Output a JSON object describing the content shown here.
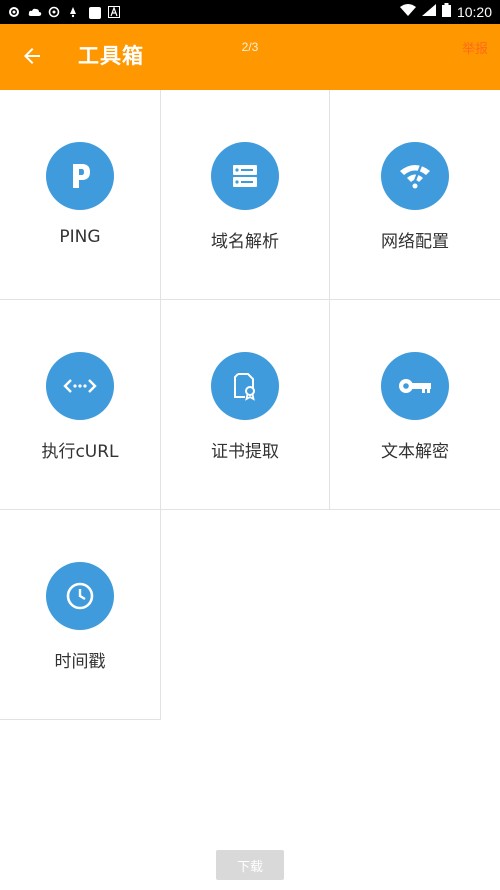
{
  "status_bar": {
    "time": "10:20"
  },
  "header": {
    "title": "工具箱",
    "page_indicator": "2/3",
    "report_link": "举报"
  },
  "tools": [
    {
      "label": "PING",
      "icon": "ping-p-icon"
    },
    {
      "label": "域名解析",
      "icon": "server-icon"
    },
    {
      "label": "网络配置",
      "icon": "wifi-icon"
    },
    {
      "label": "执行cURL",
      "icon": "code-arrows-icon"
    },
    {
      "label": "证书提取",
      "icon": "certificate-icon"
    },
    {
      "label": "文本解密",
      "icon": "key-icon"
    },
    {
      "label": "时间戳",
      "icon": "clock-icon"
    }
  ],
  "footer": {
    "download_label": "下载"
  },
  "colors": {
    "app_bar": "#FF9800",
    "icon_circle": "#3F9BDB",
    "report_link": "#FF5722"
  }
}
